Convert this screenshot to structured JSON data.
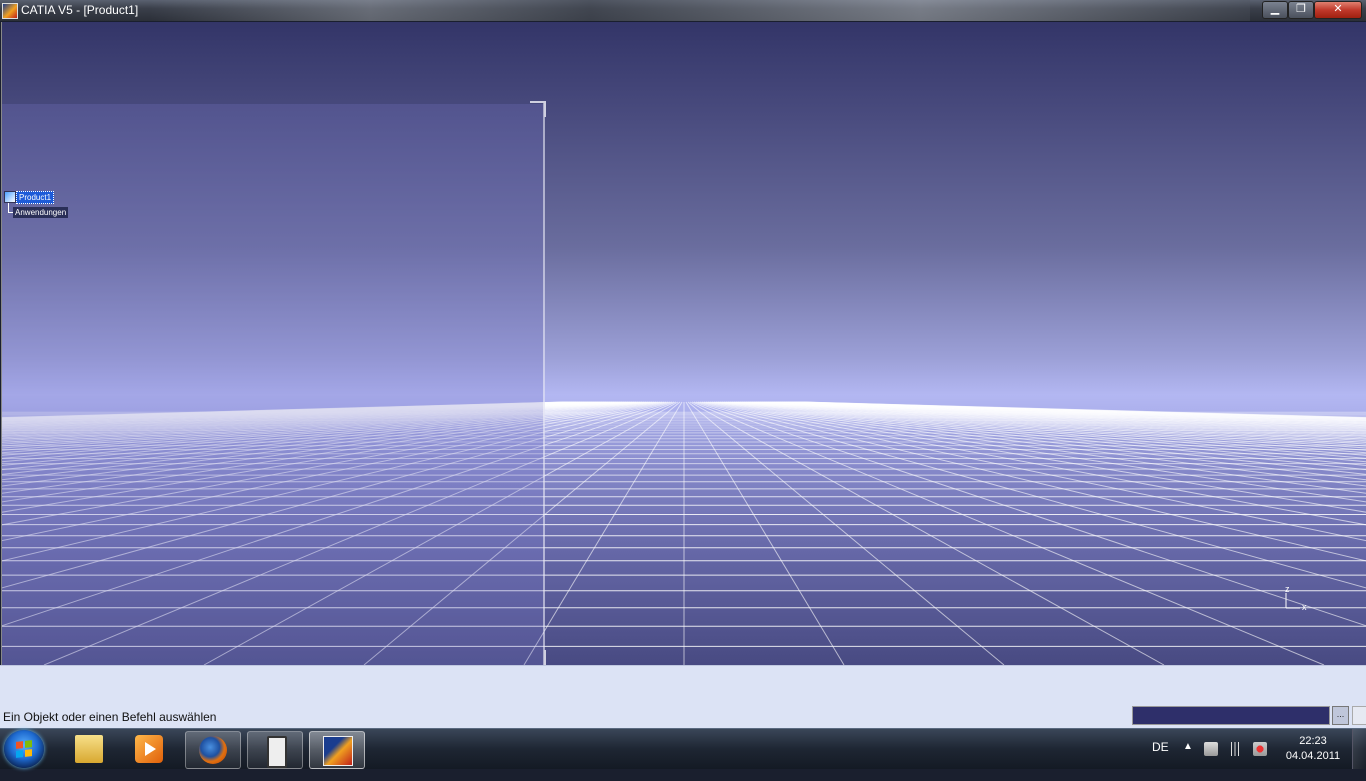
{
  "window": {
    "title": "CATIA V5 - [Product1]",
    "min_glyph": "▁",
    "max_glyph": "❐",
    "close_glyph": "✕"
  },
  "tree": {
    "root_label": "Product1",
    "child_label": "Anwendungen"
  },
  "compass": {
    "axis_z": "z",
    "axis_x": "x"
  },
  "status": {
    "message": "Ein Objekt oder einen Befehl auswählen",
    "power_input_value": "",
    "power_button_label": "..."
  },
  "taskbar": {
    "items": [
      {
        "name": "Windows Explorer",
        "icon": "folder-icon"
      },
      {
        "name": "Windows Media Player",
        "icon": "media-player-icon"
      },
      {
        "name": "Firefox",
        "icon": "firefox-icon"
      },
      {
        "name": "Phone",
        "icon": "phone-icon"
      },
      {
        "name": "CATIA V5",
        "icon": "catia-icon"
      }
    ],
    "language": "DE",
    "tray_arrow": "▲",
    "time": "22:23",
    "date": "04.04.2011"
  },
  "colors": {
    "selection": "#1e5bd8",
    "grid_line": "#ffffff",
    "status_bg": "#dce3f5"
  }
}
